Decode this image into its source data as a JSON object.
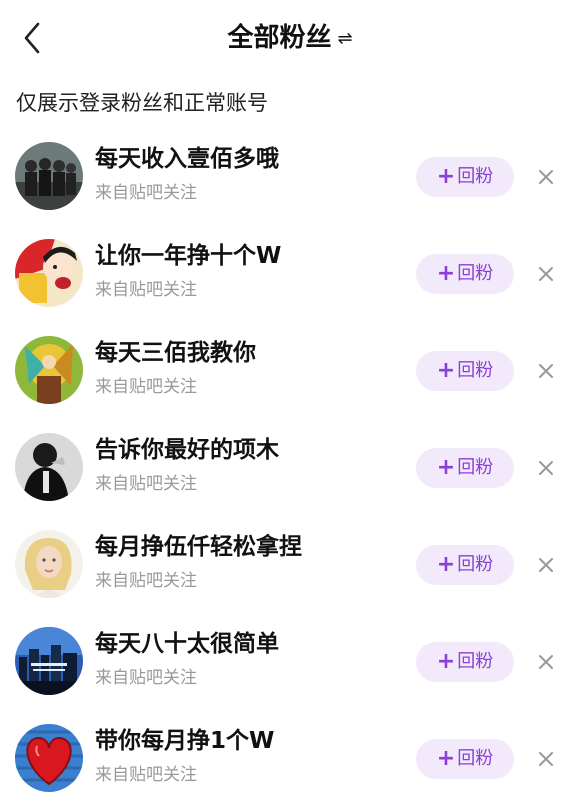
{
  "header": {
    "title": "全部粉丝",
    "swap_icon": "⇌",
    "back_icon": "back-chevron-icon"
  },
  "notice": "仅展示登录粉丝和正常账号",
  "follow_button": {
    "plus": "+",
    "label": "回粉"
  },
  "colors": {
    "button_bg": "#f2e9fb",
    "button_text": "#8a3fd6",
    "subtext": "#9a9a9a"
  },
  "followers": [
    {
      "name": "每天收入壹佰多哦",
      "source": "来自贴吧关注"
    },
    {
      "name": "让你一年挣十个W",
      "source": "来自贴吧关注"
    },
    {
      "name": "每天三佰我教你",
      "source": "来自贴吧关注"
    },
    {
      "name": "告诉你最好的项木",
      "source": "来自贴吧关注"
    },
    {
      "name": "每月挣伍仟轻松拿捏",
      "source": "来自贴吧关注"
    },
    {
      "name": "每天八十太很简单",
      "source": "来自贴吧关注"
    },
    {
      "name": "带你每月挣1个W",
      "source": "来自贴吧关注"
    }
  ]
}
